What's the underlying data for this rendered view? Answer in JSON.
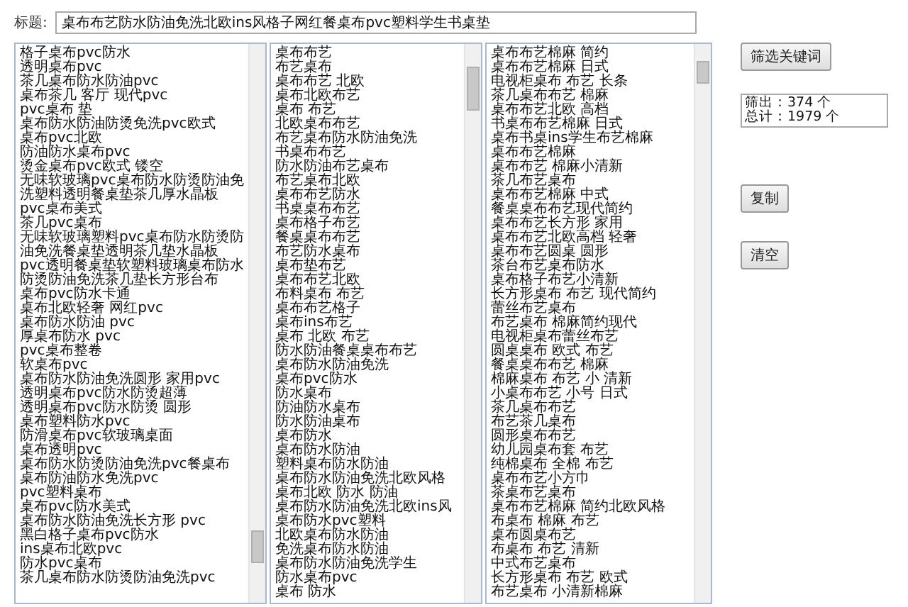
{
  "title_field": {
    "label": "标题:",
    "value": "桌布布艺防水防油免洗北欧ins风格子网红餐桌布pvc塑料学生书桌垫"
  },
  "keyword_lists": [
    {
      "lines": [
        "格子桌布pvc防水",
        "透明桌布pvc",
        "茶几桌布防水防油pvc",
        "桌布茶几 客厅 现代pvc",
        "pvc桌布 垫",
        "桌布防水防油防烫免洗pvc欧式",
        "桌布pvc北欧",
        "防油防水桌布pvc",
        "烫金桌布pvc欧式 镂空",
        "无味软玻璃pvc桌布防水防烫防油免",
        "洗塑料透明餐桌垫茶几厚水晶板",
        "pvc桌布美式",
        "茶几pvc桌布",
        "无味软玻璃塑料pvc桌布防水防烫防",
        "油免洗餐桌垫透明茶几垫水晶板",
        "pvc透明餐桌垫软塑料玻璃桌布防水",
        "防烫防油免洗茶几垫长方形台布",
        "桌布pvc防水卡通",
        "桌布北欧轻奢 网红pvc",
        "桌布防水防油 pvc",
        "厚桌布防水 pvc",
        "pvc桌布整卷",
        "软桌布pvc",
        "桌布防水防油免洗圆形 家用pvc",
        "透明桌布pvc防水防烫超薄",
        "透明桌布pvc防水防烫 圆形",
        "桌布塑料防水pvc",
        "防滑桌布pvc软玻璃桌面",
        "桌布透明pvc",
        "桌布防水防烫防油免洗pvc餐桌布",
        "桌布防油防水免洗pvc",
        "pvc塑料桌布",
        "桌布pvc防水美式",
        "桌布防水防油免洗长方形 pvc",
        "黑白格子桌布pvc防水",
        "ins桌布北欧pvc",
        "防水pvc桌布",
        "茶几桌布防水防烫防油免洗pvc"
      ]
    },
    {
      "lines": [
        "桌布布艺",
        "布艺桌布",
        "桌布布艺 北欧",
        "桌布北欧布艺",
        "桌布 布艺",
        "北欧桌布布艺",
        "布艺桌布防水防油免洗",
        "书桌布布艺",
        "防水防油布艺桌布",
        "布艺桌布北欧",
        "桌布布艺防水",
        "书桌桌布布艺",
        "桌布格子布艺",
        "餐桌桌布布艺",
        "布艺防水桌布",
        "桌布垫布艺",
        "桌布布艺北欧",
        "布料桌布 布艺",
        "桌布布艺格子",
        "桌布ins布艺",
        "桌布 北欧 布艺",
        "防水防油餐桌桌布布艺",
        "桌布防水防油免洗",
        "桌布pvc防水",
        "防水桌布",
        "防油防水桌布",
        "防水防油桌布",
        "桌布防水",
        "桌布防水防油",
        "塑料桌布防水防油",
        "桌布防水防油免洗北欧风格",
        "桌布北欧 防水 防油",
        "桌布防水防油免洗北欧ins风",
        "桌布防水pvc塑料",
        "北欧桌布防水防油",
        "免洗桌布防水防油",
        "桌布防水防油免洗学生",
        "防水桌布pvc",
        "桌布 防水"
      ]
    },
    {
      "lines": [
        "桌布布艺棉麻 简约",
        "桌布布艺棉麻 日式",
        "电视柜桌布 布艺 长条",
        "茶几桌布布艺 棉麻",
        "桌布布艺北欧 高档",
        "书桌布布艺棉麻 日式",
        "桌布书桌ins学生布艺棉麻",
        "桌布布艺棉麻",
        "桌布布艺 棉麻小清新",
        "茶几布艺桌布",
        "桌布布艺棉麻 中式",
        "餐桌桌布布艺现代简约",
        "桌布布艺长方形 家用",
        "桌布布艺北欧高档 轻奢",
        "桌布布艺圆桌 圆形",
        "茶台布艺桌布防水",
        "桌布格子布艺小清新",
        "长方形桌布 布艺 现代简约",
        "蕾丝布艺桌布",
        "布艺桌布 棉麻简约现代",
        "电视柜桌布蕾丝布艺",
        "圆桌桌布 欧式 布艺",
        "餐桌桌布布艺 棉麻",
        "棉麻桌布 布艺 小 清新",
        "小桌布布艺 小号 日式",
        "茶几桌布布艺",
        "布艺茶几桌布",
        "圆形桌布布艺",
        "幼儿园桌布套 布艺",
        "纯棉桌布 全棉 布艺",
        "桌布布艺小方巾",
        "茶桌布艺桌布",
        "桌布布艺棉麻 简约北欧风格",
        "布桌布 棉麻 布艺",
        "桌布圆桌布艺",
        "布桌布 布艺 清新",
        "中式布艺桌布",
        "长方形桌布 布艺 欧式",
        "布艺桌布 小清新棉麻"
      ]
    }
  ],
  "filter_button": "筛选关键词",
  "result_box": {
    "lines": [
      "筛出：374 个",
      "总计：1979 个"
    ]
  },
  "copy_button": "复制",
  "clear_button": "清空"
}
